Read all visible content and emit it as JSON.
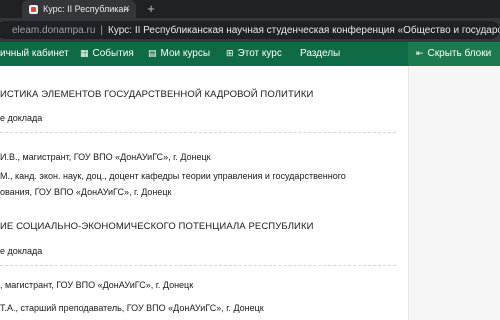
{
  "browser": {
    "tab_title": "Курс: II Республиканская",
    "tab_close": "×",
    "new_tab": "+",
    "url": "eleam.donampa.ru",
    "page_title": "Курс: II Республиканская научная студенческая конференция «Общество и государство..."
  },
  "navbar": {
    "items": [
      {
        "label": "ичный кабинет",
        "icon": ""
      },
      {
        "label": "События",
        "icon": "▦"
      },
      {
        "label": "Мои курсы",
        "icon": "▤"
      },
      {
        "label": "Этот курс",
        "icon": "⊞"
      },
      {
        "label": "Разделы",
        "icon": ""
      }
    ],
    "right": {
      "label": "Скрыть блоки",
      "icon": "⇤"
    },
    "colors": {
      "bar": "#0f6b45",
      "right": "#1d7a4e"
    }
  },
  "content": {
    "sections": [
      {
        "heading": "ИСТИКА ЭЛЕМЕНТОВ ГОСУДАРСТВЕННОЙ КАДРОВОЙ ПОЛИТИКИ",
        "subhead": "е доклада",
        "lines": [
          "И.В., магистрант,  ГОУ ВПО «ДонАУиГС», г. Донецк",
          "М., канд. экон. наук, доц., доцент кафедры теории управления и государственного",
          "ования, ГОУ ВПО «ДонАУиГС», г. Донецк"
        ]
      },
      {
        "heading": "ИЕ СОЦИАЛЬНО-ЭКОНОМИЧЕСКОГО ПОТЕНЦИАЛА РЕСПУБЛИКИ",
        "subhead": "е доклада",
        "lines": [
          ", магистрант, ГОУ ВПО «ДонАУиГС», г. Донецк",
          "Т.А., старший преподаватель, ГОУ ВПО «ДонАУиГС», г. Донецк"
        ]
      }
    ]
  }
}
